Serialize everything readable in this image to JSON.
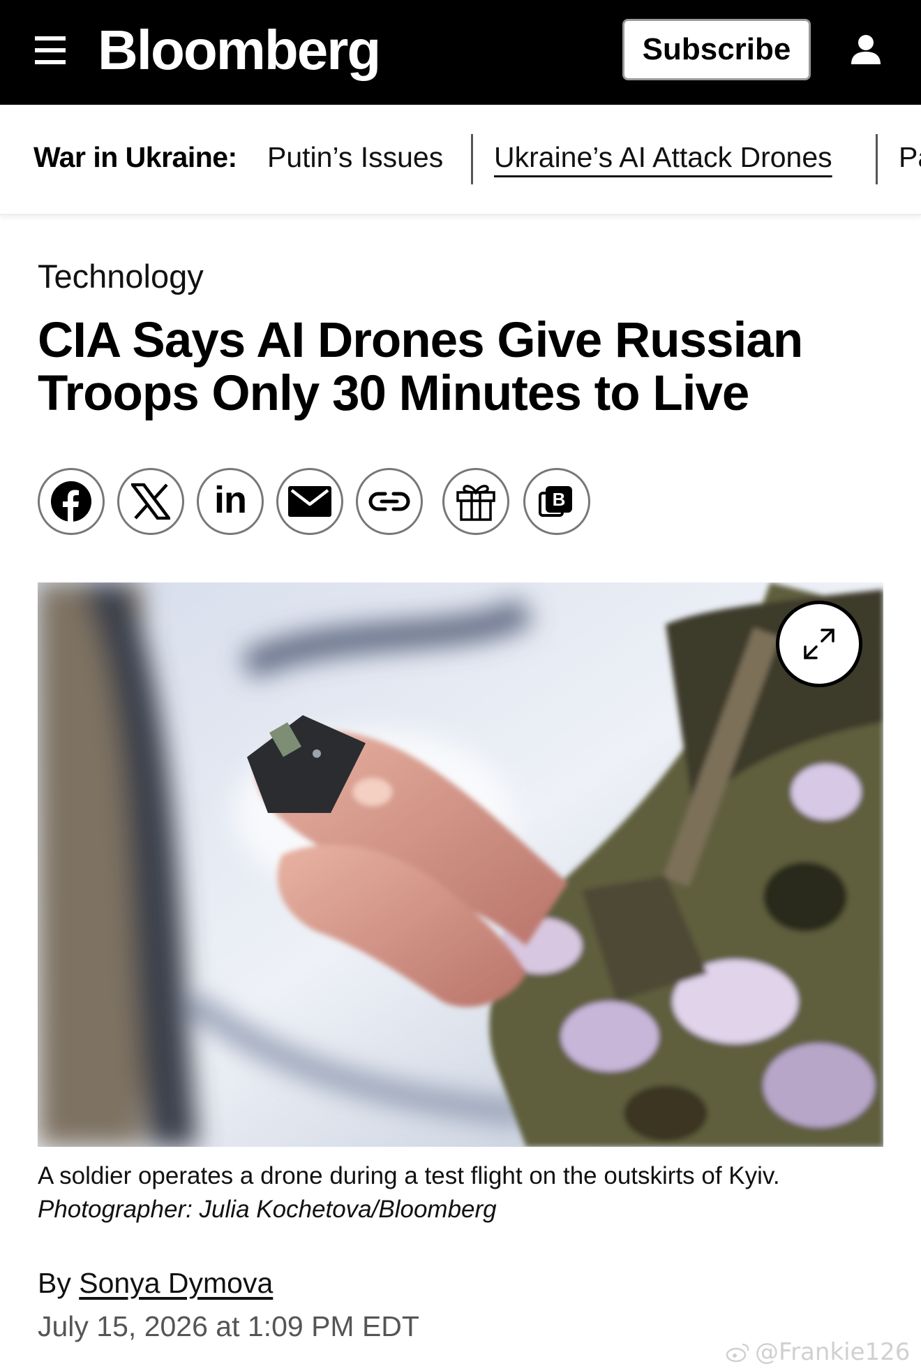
{
  "topbar": {
    "brand": "Bloomberg",
    "subscribe_label": "Subscribe",
    "menu_icon": "hamburger-menu-icon",
    "account_icon": "user-account-icon"
  },
  "nav": {
    "label": "War in Ukraine:",
    "items": [
      {
        "label": "Putin’s Issues",
        "active": false
      },
      {
        "label": "Ukraine’s AI Attack Drones",
        "active": true
      },
      {
        "label": "Pa",
        "active": false
      }
    ]
  },
  "article": {
    "category": "Technology",
    "headline_line1": "CIA Says AI Drones Give Russian",
    "headline_line2": "Troops Only 30 Minutes to Live",
    "caption_text": "A soldier operates a drone during a test flight on the outskirts of Kyiv.",
    "caption_credit": "Photographer: Julia Kochetova/Bloomberg",
    "byline_prefix": "By",
    "author": "Sonya Dymova",
    "date": "July 15, 2026 at 1:09 PM EDT"
  },
  "share": {
    "icons": [
      "facebook-icon",
      "x-icon",
      "linkedin-icon",
      "email-icon",
      "link-icon",
      "gift-icon",
      "bloomberg-terminal-icon"
    ],
    "linkedin_text": "in",
    "terminal_text": "B"
  },
  "image": {
    "expand_icon": "expand-icon"
  },
  "watermark": {
    "text": "@Frankie126"
  },
  "colors": {
    "topbar_bg": "#000000",
    "text": "#111111",
    "muted": "#555555"
  }
}
